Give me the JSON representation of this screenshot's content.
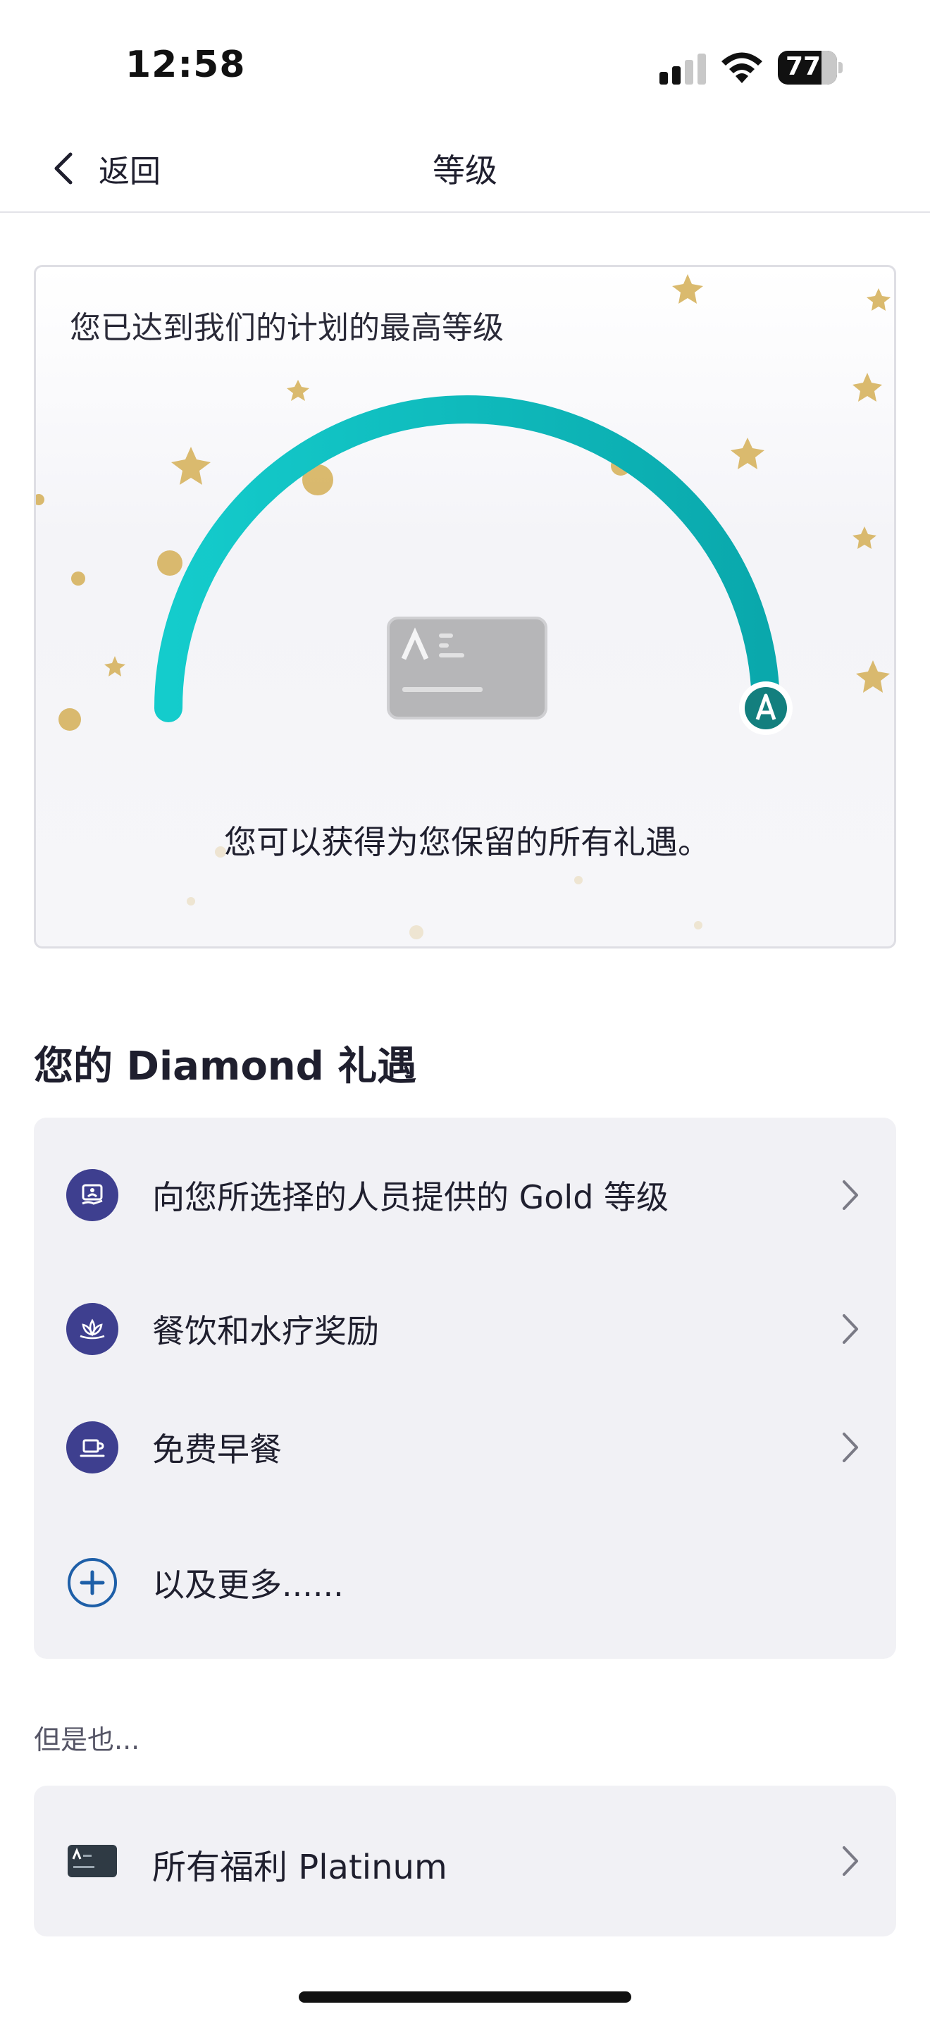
{
  "status_bar": {
    "time": "12:58",
    "battery": "77"
  },
  "nav": {
    "back_label": "返回",
    "title": "等级"
  },
  "hero": {
    "headline": "您已达到我们的计划的最高等级",
    "subtitle": "您可以获得为您保留的所有礼遇。",
    "progress": 1.0,
    "accent_color": "#12c2c2"
  },
  "benefits": {
    "title": "您的 Diamond 礼遇",
    "items": [
      {
        "label": "向您所选择的人员提供的 Gold 等级",
        "icon": "person-badge-icon"
      },
      {
        "label": "餐饮和水疗奖励",
        "icon": "lotus-icon"
      },
      {
        "label": "免费早餐",
        "icon": "coffee-cup-icon"
      },
      {
        "label": "以及更多......",
        "icon": "plus-circle-icon"
      }
    ]
  },
  "also": {
    "label": "但是也...",
    "item": {
      "label": "所有福利 Platinum",
      "icon": "membership-card-icon"
    }
  },
  "colors": {
    "icon_bg": "#3e3f8f",
    "card_bg": "#f1f1f5",
    "gold": "#d6b25e"
  }
}
